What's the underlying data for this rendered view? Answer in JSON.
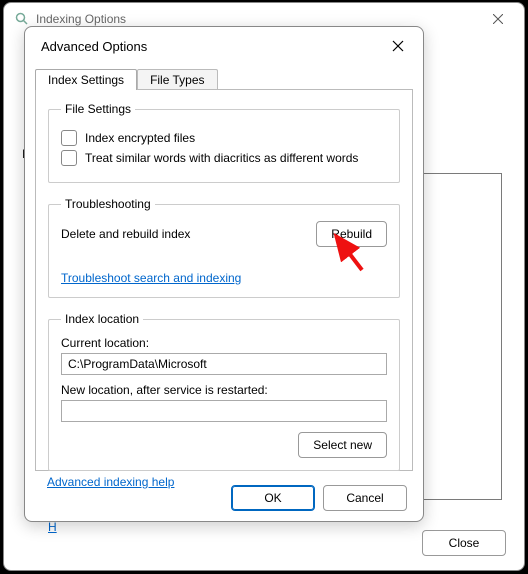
{
  "parent": {
    "title": "Indexing Options",
    "listHeader": "I",
    "helpLink": "H",
    "closeBtn": "Close"
  },
  "child": {
    "title": "Advanced Options",
    "tabs": {
      "settings": "Index Settings",
      "fileTypes": "File Types"
    },
    "fileSettings": {
      "legend": "File Settings",
      "encrypted": "Index encrypted files",
      "diacritics": "Treat similar words with diacritics as different words"
    },
    "troubleshooting": {
      "legend": "Troubleshooting",
      "rebuildLabel": "Delete and rebuild index",
      "rebuildBtn": "Rebuild",
      "link": "Troubleshoot search and indexing"
    },
    "indexLocation": {
      "legend": "Index location",
      "currentLabel": "Current location:",
      "currentValue": "C:\\ProgramData\\Microsoft",
      "newLabel": "New location, after service is restarted:",
      "newValue": "",
      "selectBtn": "Select new"
    },
    "helpLink": "Advanced indexing help",
    "okBtn": "OK",
    "cancelBtn": "Cancel"
  }
}
